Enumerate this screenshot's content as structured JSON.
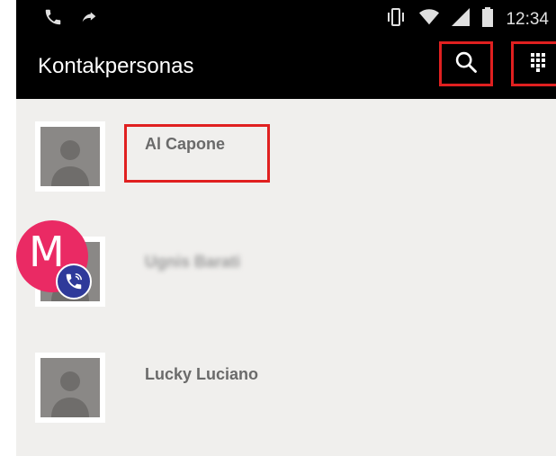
{
  "header": {
    "title": "Kontakpersonas"
  },
  "statusbar": {
    "time": "12:34"
  },
  "icons": {
    "phone": "phone-icon",
    "forward": "call-forward-icon",
    "vibrate": "vibrate-icon",
    "wifi": "wifi-icon",
    "signal": "signal-icon",
    "battery": "battery-icon",
    "search": "search-icon",
    "dialpad": "dialpad-icon"
  },
  "contacts": [
    {
      "name": "Al Capone"
    },
    {
      "name": "Ugnis Barati"
    },
    {
      "name": "Lucky Luciano"
    }
  ],
  "fab": {
    "letter": "M"
  },
  "colors": {
    "highlight": "#e02020",
    "fab": "#ea2a64",
    "badge": "#2f3a9a"
  }
}
